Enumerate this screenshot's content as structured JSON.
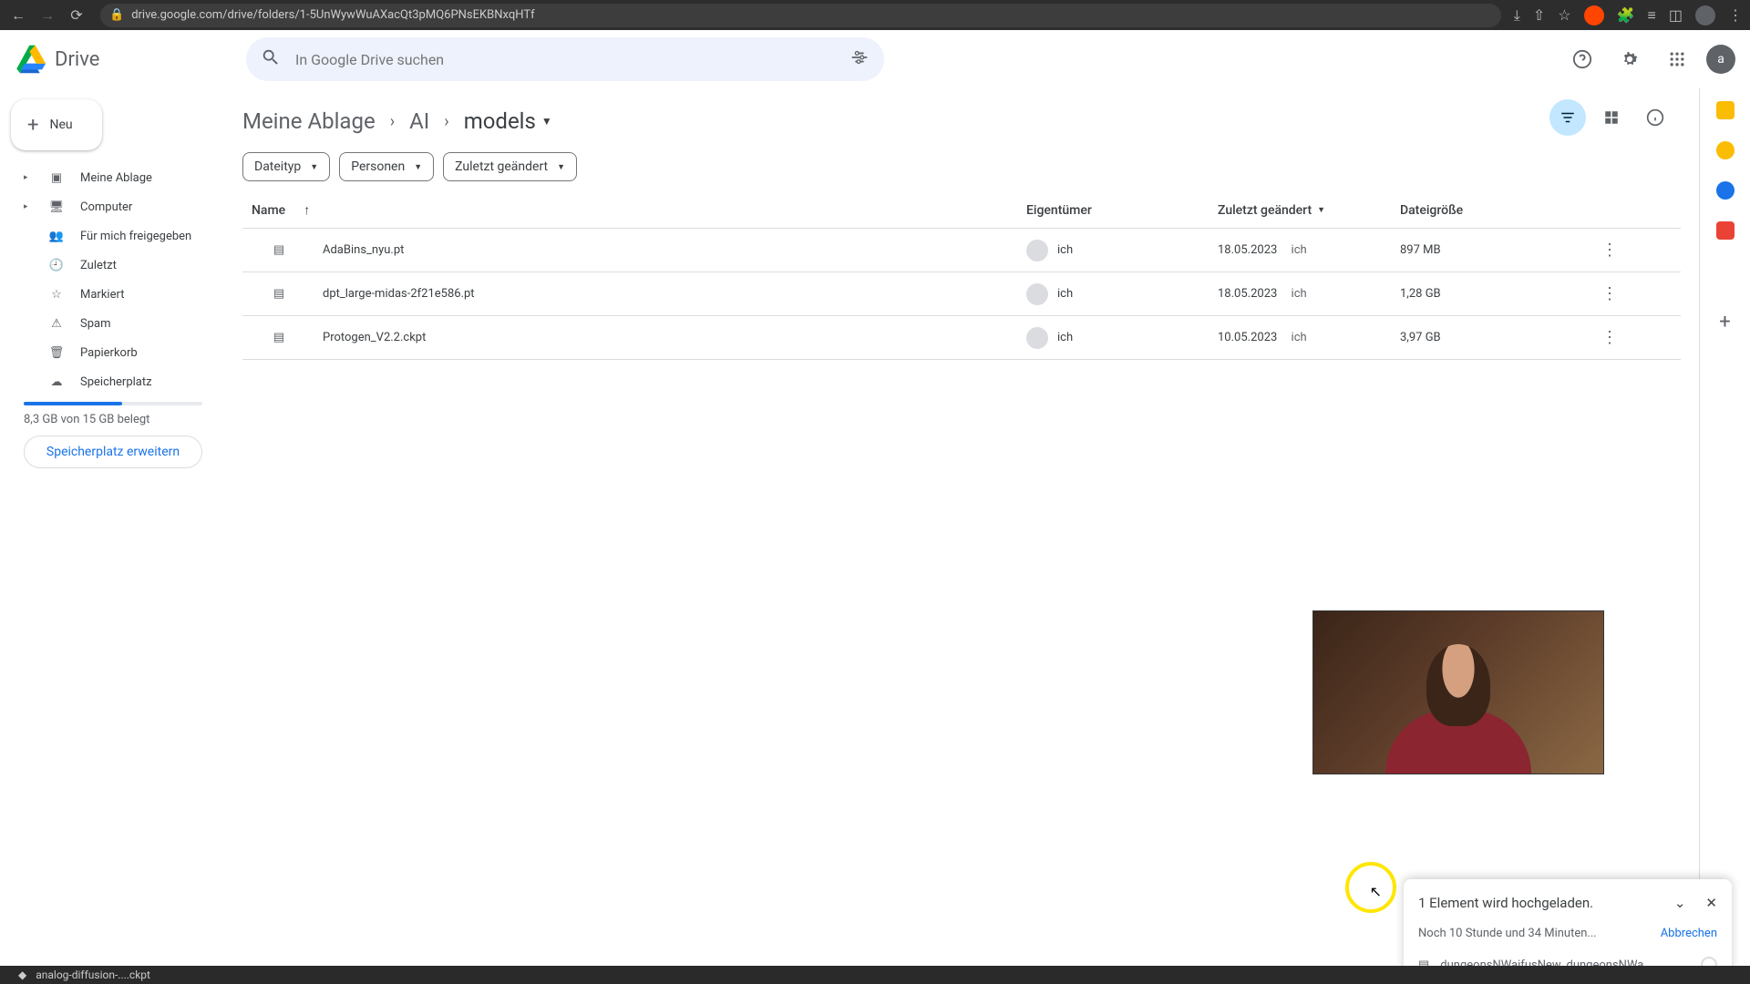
{
  "browser": {
    "url": "drive.google.com/drive/folders/1-5UnWywWuAXacQt3pMQ6PNsEKBNxqHTf"
  },
  "app": {
    "name": "Drive",
    "avatar_letter": "a"
  },
  "search": {
    "placeholder": "In Google Drive suchen"
  },
  "new_button": "Neu",
  "sidebar": {
    "items": [
      {
        "label": "Meine Ablage",
        "expandable": true
      },
      {
        "label": "Computer",
        "expandable": true
      },
      {
        "label": "Für mich freigegeben",
        "expandable": false
      },
      {
        "label": "Zuletzt",
        "expandable": false
      },
      {
        "label": "Markiert",
        "expandable": false
      },
      {
        "label": "Spam",
        "expandable": false
      },
      {
        "label": "Papierkorb",
        "expandable": false
      },
      {
        "label": "Speicherplatz",
        "expandable": false
      }
    ],
    "storage_text": "8,3 GB von 15 GB belegt",
    "upgrade": "Speicherplatz erweitern"
  },
  "breadcrumb": [
    "Meine Ablage",
    "AI",
    "models"
  ],
  "filters": [
    "Dateityp",
    "Personen",
    "Zuletzt geändert"
  ],
  "columns": {
    "name": "Name",
    "owner": "Eigentümer",
    "modified": "Zuletzt geändert",
    "size": "Dateigröße"
  },
  "owner_me": "ich",
  "files": [
    {
      "name": "AdaBins_nyu.pt",
      "modified": "18.05.2023",
      "mod_by": "ich",
      "size": "897 MB"
    },
    {
      "name": "dpt_large-midas-2f21e586.pt",
      "modified": "18.05.2023",
      "mod_by": "ich",
      "size": "1,28 GB"
    },
    {
      "name": "Protogen_V2.2.ckpt",
      "modified": "10.05.2023",
      "mod_by": "ich",
      "size": "3,97 GB"
    }
  ],
  "upload": {
    "title": "1 Element wird hochgeladen.",
    "time": "Noch 10 Stunde und 34 Minuten...",
    "cancel": "Abbrechen",
    "file": "dungeonsNWaifusNew_dungeonsNWa..."
  },
  "download": {
    "file": "analog-diffusion-....ckpt"
  }
}
